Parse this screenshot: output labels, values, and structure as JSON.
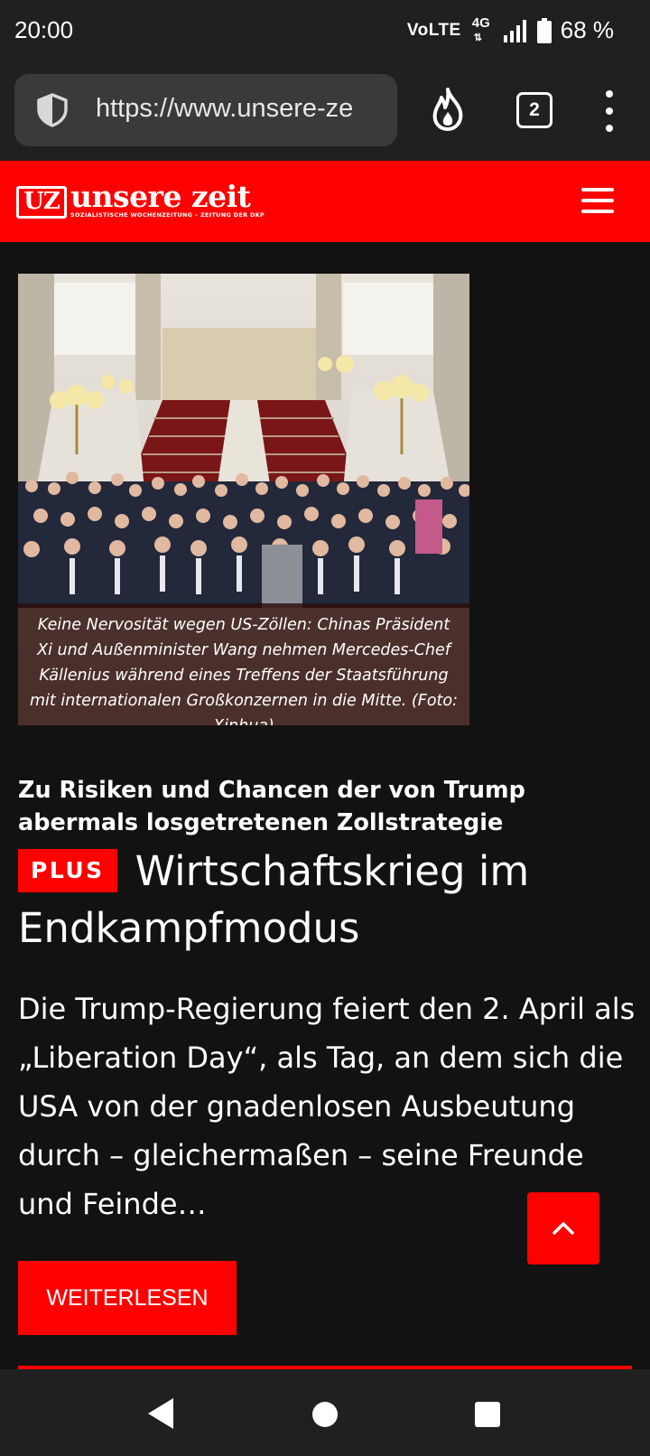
{
  "status_bar": {
    "time": "20:00",
    "volte": "VoLTE",
    "network": "4G",
    "battery": "68 %"
  },
  "browser": {
    "url": "https://www.unsere-ze",
    "tab_count": "2"
  },
  "site": {
    "logo_short": "UZ",
    "logo_name": "unsere zeit",
    "logo_tagline": "SOZIALISTISCHE WOCHENZEITUNG – ZEITUNG DER DKP",
    "brand_color": "#ff0000"
  },
  "article": {
    "image_caption": "Keine Nervosität wegen US-Zöllen: Chinas Präsident Xi und Außenminister Wang nehmen Mercedes-Chef Källenius während eines Treffens der Staatsführung mit internationalen Großkonzernen in die Mitte. (Foto: Xinhua)",
    "kicker": "Zu Risiken und Chancen der von Trump abermals losgetretenen Zollstrategie",
    "badge": "PLUS",
    "title": "Wirtschaftskrieg im Endkampfmodus",
    "teaser": "Die Trump-Regierung feiert den 2. April als „Liberation Day“, als Tag, an dem sich die USA von der gnadenlosen Ausbeutung durch – gleichermaßen – seine Freunde und Feinde…",
    "read_more": "WEITERLESEN"
  }
}
